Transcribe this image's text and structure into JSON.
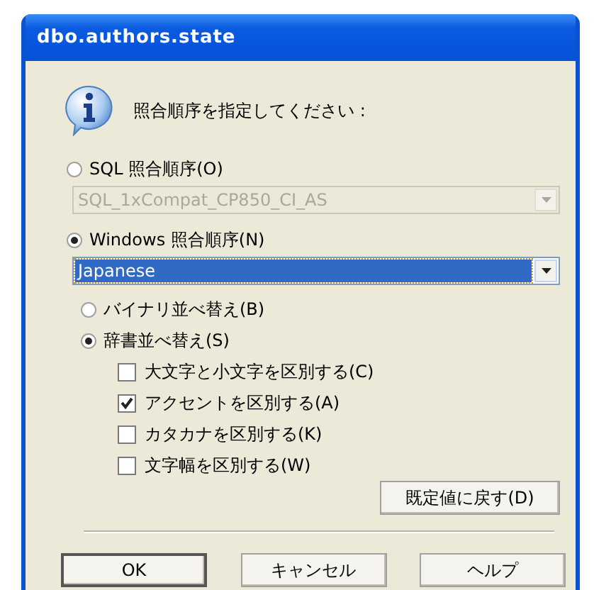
{
  "window": {
    "title": "dbo.authors.state"
  },
  "prompt": "照合順序を指定してください :",
  "collation_sources": [
    {
      "label": "SQL 照合順序(O)",
      "selected": false,
      "combo": {
        "value": "SQL_1xCompat_CP850_CI_AS",
        "disabled": true
      }
    },
    {
      "label": "Windows 照合順序(N)",
      "selected": true,
      "combo": {
        "value": "Japanese",
        "disabled": false
      }
    }
  ],
  "sort_orders": [
    {
      "label": "バイナリ並べ替え(B)",
      "selected": false
    },
    {
      "label": "辞書並べ替え(S)",
      "selected": true
    }
  ],
  "options": [
    {
      "label": "大文字と小文字を区別する(C)",
      "checked": false
    },
    {
      "label": "アクセントを区別する(A)",
      "checked": true
    },
    {
      "label": "カタカナを区別する(K)",
      "checked": false
    },
    {
      "label": "文字幅を区別する(W)",
      "checked": false
    }
  ],
  "reset_button": "既定値に戻す(D)",
  "buttons": [
    {
      "label": "OK",
      "default": true
    },
    {
      "label": "キャンセル",
      "default": false
    },
    {
      "label": "ヘルプ",
      "default": false
    }
  ]
}
